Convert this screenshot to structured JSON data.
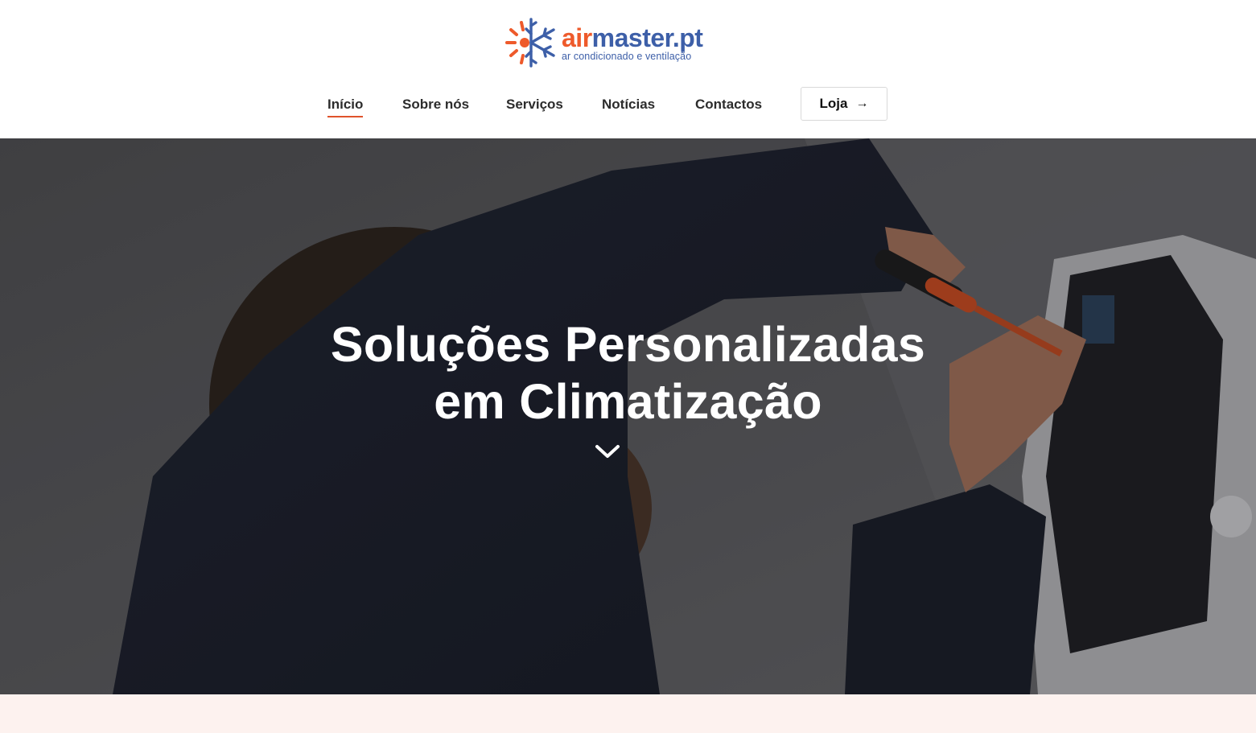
{
  "brand": {
    "name_part1": "air",
    "name_part2": "master.pt",
    "tagline": "ar condicionado e ventilação",
    "colors": {
      "orange": "#ee5a2b",
      "blue": "#3d5fa8"
    }
  },
  "nav": {
    "items": [
      {
        "label": "Início",
        "active": true
      },
      {
        "label": "Sobre nós",
        "active": false
      },
      {
        "label": "Serviços",
        "active": false
      },
      {
        "label": "Notícias",
        "active": false
      },
      {
        "label": "Contactos",
        "active": false
      }
    ],
    "cta": {
      "label": "Loja",
      "icon": "arrow-right-icon",
      "arrow": "→"
    },
    "active_color": "#e0532b"
  },
  "hero": {
    "title_line1": "Soluções Personalizadas",
    "title_line2": "em Climatização",
    "scroll_icon": "chevron-down-icon",
    "image": "technician-repairing-air-conditioner"
  },
  "footer_band": {
    "color": "#fdf2ef"
  }
}
